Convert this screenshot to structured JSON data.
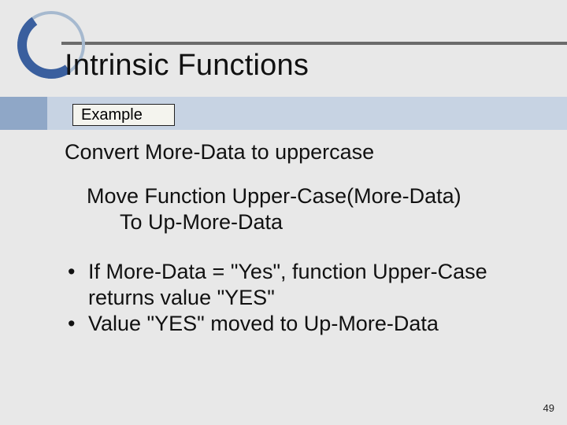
{
  "title": "Intrinsic Functions",
  "example_label": "Example",
  "subtitle": "Convert More-Data to uppercase",
  "code": {
    "line1": "Move Function Upper-Case(More-Data)",
    "line2": "To Up-More-Data"
  },
  "bullets": [
    "If More-Data = \"Yes\", function Upper-Case returns value \"YES\"",
    "Value \"YES\" moved to Up-More-Data"
  ],
  "page_number": "49"
}
